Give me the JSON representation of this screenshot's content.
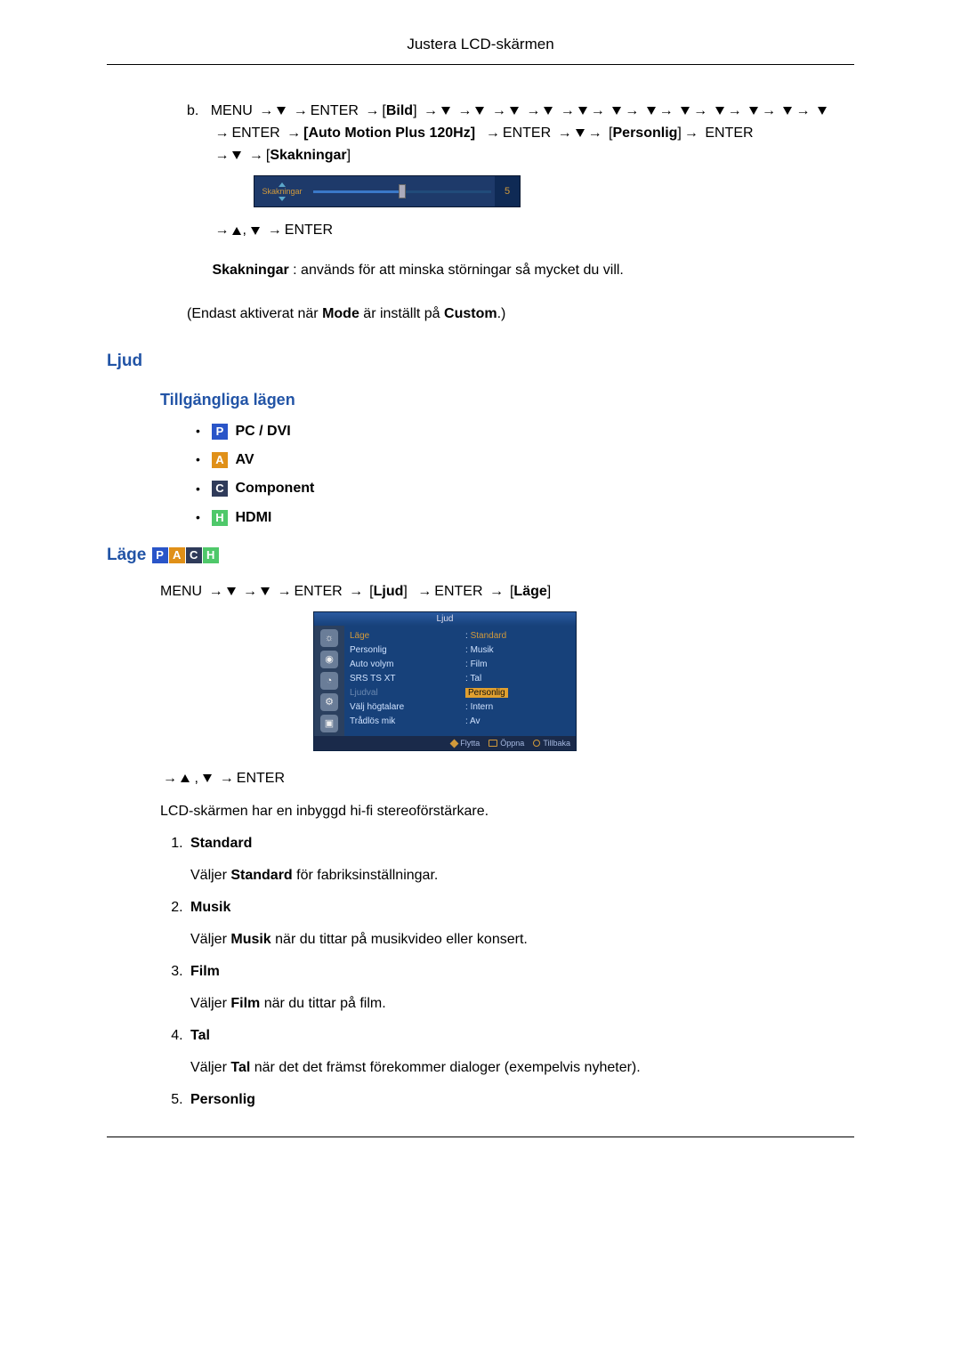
{
  "header": {
    "title": "Justera LCD-skärmen"
  },
  "step_b": {
    "letter": "b.",
    "menu": "MENU",
    "enter": "ENTER",
    "bild": "Bild",
    "auto_motion": "Auto Motion Plus 120Hz",
    "personlig": "Personlig",
    "skakningar": "Skakningar"
  },
  "slider": {
    "label": "Skakningar",
    "value": "5"
  },
  "to_enter": "ENTER",
  "skak_line": {
    "label": "Skakningar",
    "text": " : används för att minska störningar så mycket du vill."
  },
  "only_active": {
    "pre": "(Endast aktiverat när ",
    "mode": "Mode",
    "mid": " är inställt på ",
    "custom": "Custom",
    "post": ".)"
  },
  "ljud_heading": "Ljud",
  "modes_heading": "Tillgängliga lägen",
  "modes": {
    "p": "PC / DVI",
    "a": "AV",
    "c": "Component",
    "h": "HDMI"
  },
  "lage_heading": "Läge",
  "nav": {
    "menu": "MENU",
    "enter": "ENTER",
    "ljud": "Ljud",
    "lage": "Läge"
  },
  "osd": {
    "title": "Ljud",
    "left": [
      "Läge",
      "Personlig",
      "Auto volym",
      "SRS TS XT",
      "Ljudval",
      "Välj högtalare",
      "Trådlös mik"
    ],
    "right": [
      "Standard",
      "Musik",
      "Film",
      "Tal",
      "Personlig",
      "Intern",
      "Av"
    ],
    "footer": {
      "move": "Flytta",
      "open": "Öppna",
      "back": "Tillbaka"
    }
  },
  "lcd_desc": "LCD-skärmen har en inbyggd hi-fi stereoförstärkare.",
  "list": [
    {
      "name": "Standard",
      "desc_pre": "Väljer ",
      "desc_bold": "Standard",
      "desc_post": " för fabriksinställningar."
    },
    {
      "name": "Musik",
      "desc_pre": "Väljer ",
      "desc_bold": "Musik",
      "desc_post": " när du tittar på musikvideo eller konsert."
    },
    {
      "name": "Film",
      "desc_pre": "Väljer ",
      "desc_bold": "Film",
      "desc_post": " när du tittar på film."
    },
    {
      "name": "Tal",
      "desc_pre": "Väljer ",
      "desc_bold": "Tal",
      "desc_post": " när det det främst förekommer dialoger (exempelvis nyheter)."
    },
    {
      "name": "Personlig"
    }
  ]
}
